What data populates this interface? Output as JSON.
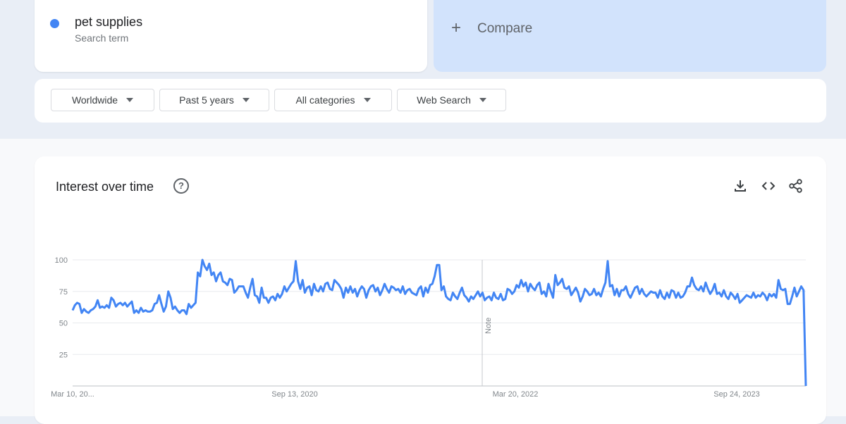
{
  "search_term": {
    "name": "pet supplies",
    "subtitle": "Search term",
    "color": "#4285f4"
  },
  "compare": {
    "label": "Compare",
    "icon": "plus-icon"
  },
  "filters": [
    {
      "label": "Worldwide"
    },
    {
      "label": "Past 5 years"
    },
    {
      "label": "All categories"
    },
    {
      "label": "Web Search"
    }
  ],
  "panel": {
    "title": "Interest over time",
    "help_icon": "help-circle-icon",
    "tools": [
      "download-icon",
      "embed-code-icon",
      "share-icon"
    ]
  },
  "chart_data": {
    "type": "line",
    "title": "",
    "ylim": [
      0,
      100
    ],
    "y_ticks": [
      "100",
      "75",
      "50",
      "25"
    ],
    "x_ticks": [
      "Mar 10, 20...",
      "Sep 13, 2020",
      "Mar 20, 2022",
      "Sep 24, 2023"
    ],
    "annotation": "Note",
    "line_color": "#4285f4",
    "grid": true,
    "series": [
      {
        "values": [
          60,
          64,
          66,
          65,
          58,
          61,
          59,
          58,
          60,
          61,
          63,
          68,
          62,
          63,
          62,
          64,
          62,
          70,
          68,
          63,
          65,
          66,
          64,
          66,
          63,
          65,
          67,
          58,
          60,
          58,
          62,
          59,
          60,
          59,
          59,
          60,
          65,
          66,
          72,
          65,
          59,
          63,
          75,
          70,
          61,
          63,
          60,
          58,
          60,
          60,
          57,
          65,
          62,
          64,
          66,
          90,
          87,
          100,
          95,
          92,
          97,
          88,
          90,
          83,
          88,
          90,
          83,
          82,
          80,
          85,
          84,
          74,
          76,
          79,
          79,
          79,
          74,
          70,
          78,
          85,
          72,
          71,
          66,
          78,
          70,
          70,
          66,
          70,
          71,
          68,
          73,
          70,
          73,
          79,
          75,
          78,
          81,
          83,
          99,
          83,
          77,
          84,
          74,
          78,
          79,
          72,
          81,
          76,
          75,
          79,
          75,
          81,
          82,
          77,
          76,
          84,
          82,
          80,
          77,
          70,
          78,
          74,
          79,
          74,
          77,
          71,
          76,
          79,
          77,
          70,
          76,
          79,
          80,
          75,
          78,
          72,
          76,
          81,
          77,
          74,
          79,
          78,
          76,
          77,
          74,
          79,
          73,
          76,
          77,
          74,
          73,
          72,
          77,
          79,
          71,
          78,
          74,
          80,
          81,
          87,
          96,
          96,
          76,
          79,
          71,
          69,
          68,
          74,
          71,
          69,
          74,
          78,
          72,
          70,
          67,
          71,
          69,
          72,
          75,
          71,
          74,
          68,
          70,
          71,
          68,
          74,
          70,
          69,
          73,
          68,
          69,
          77,
          76,
          73,
          75,
          80,
          78,
          84,
          79,
          82,
          75,
          81,
          78,
          76,
          80,
          82,
          73,
          75,
          71,
          81,
          75,
          70,
          88,
          80,
          82,
          85,
          78,
          77,
          79,
          72,
          75,
          78,
          74,
          67,
          71,
          77,
          75,
          72,
          73,
          77,
          72,
          74,
          71,
          77,
          82,
          99,
          79,
          80,
          72,
          77,
          71,
          76,
          76,
          79,
          73,
          70,
          74,
          78,
          79,
          73,
          77,
          73,
          71,
          73,
          75,
          74,
          74,
          70,
          76,
          71,
          69,
          74,
          70,
          76,
          75,
          70,
          74,
          70,
          71,
          74,
          79,
          79,
          86,
          80,
          77,
          76,
          79,
          75,
          82,
          77,
          73,
          76,
          81,
          73,
          74,
          71,
          76,
          71,
          69,
          74,
          72,
          69,
          73,
          66,
          68,
          70,
          72,
          71,
          70,
          74,
          70,
          72,
          71,
          74,
          72,
          68,
          73,
          71,
          73,
          70,
          84,
          77,
          76,
          77,
          65,
          65,
          71,
          78,
          71,
          75,
          79,
          76,
          0
        ]
      }
    ]
  }
}
